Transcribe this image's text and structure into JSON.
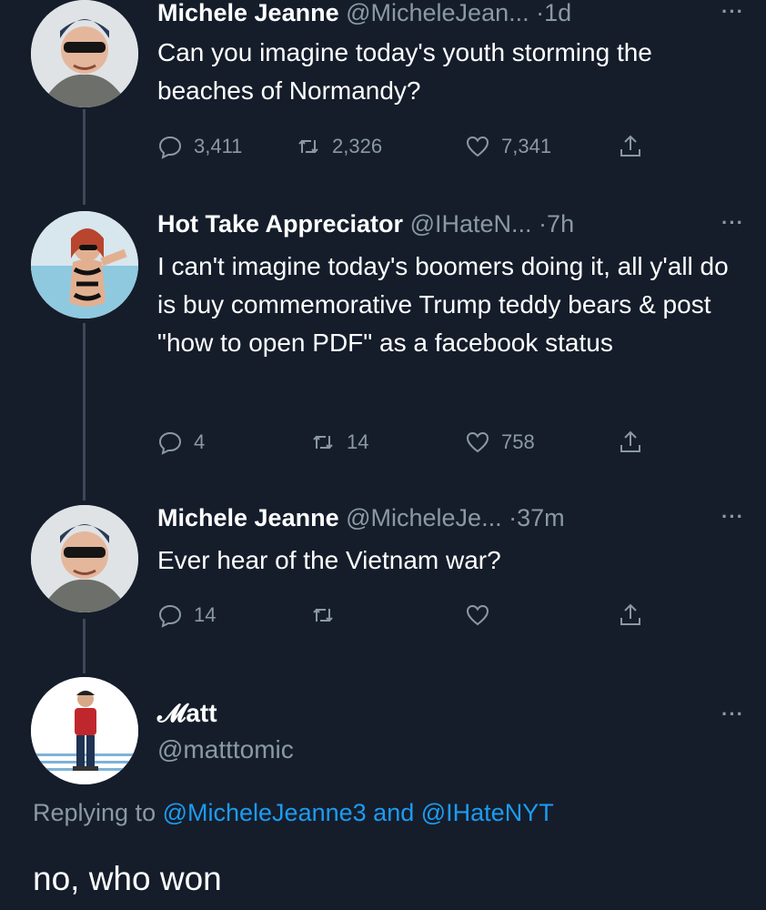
{
  "tweets": [
    {
      "name": "Michele Jeanne",
      "handle": "@MicheleJean...",
      "dot": "·",
      "time": "1d",
      "more": "···",
      "text": "Can you imagine today's youth storming the beaches of Normandy?",
      "replies": "3,411",
      "retweets": "2,326",
      "likes": "7,341"
    },
    {
      "name": "Hot Take Appreciator",
      "handle": "@IHateN...",
      "dot": "·",
      "time": "7h",
      "more": "···",
      "text": "I can't imagine today's boomers doing it, all y'all do is buy commemorative Trump teddy bears & post \"how to open PDF\" as a facebook status",
      "replies": "4",
      "retweets": "14",
      "likes": "758"
    },
    {
      "name": "Michele Jeanne",
      "handle": "@MicheleJe...",
      "dot": "·",
      "time": "37m",
      "more": "···",
      "text": "Ever hear of the Vietnam war?",
      "replies": "14",
      "retweets": "",
      "likes": ""
    }
  ],
  "reply": {
    "name": "Matt",
    "name_display": "𝓜att",
    "handle": "@matttomic",
    "more": "···",
    "replying_prefix": "Replying to",
    "mention1": "@MicheleJeanne3",
    "conjunction": "and",
    "mention2": "@IHateNYT",
    "text": "no, who won"
  },
  "icons": [
    "reply-icon",
    "retweet-icon",
    "like-icon",
    "share-icon"
  ],
  "colors": {
    "background": "#151d2b",
    "text": "#ffffff",
    "muted": "#8b98a5",
    "accent": "#1d9bf0"
  }
}
